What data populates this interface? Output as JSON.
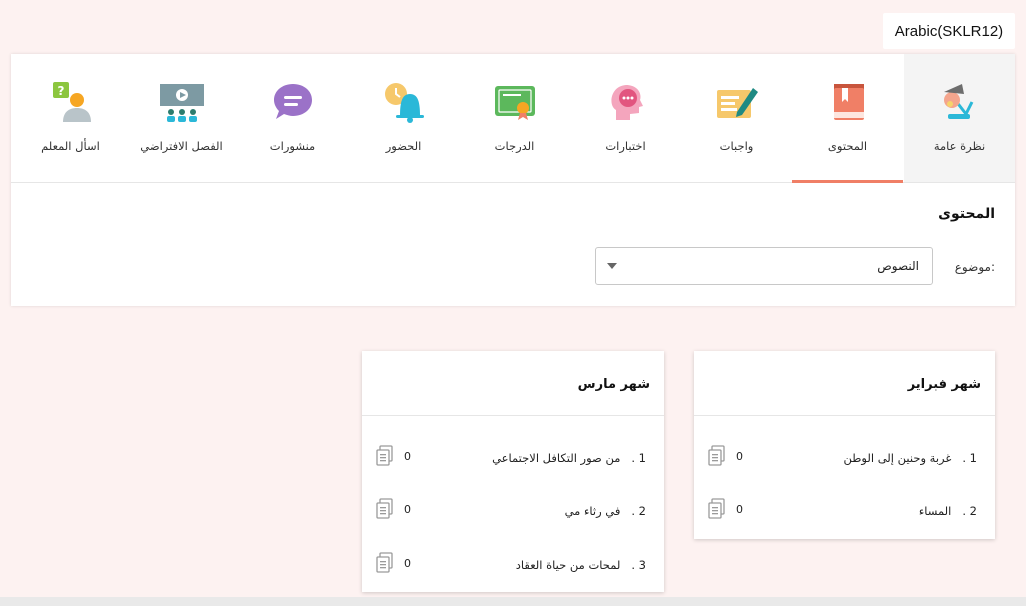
{
  "course": "Arabic(SKLR12)",
  "tabs": [
    {
      "label": "نظرة عامة",
      "icon": "lamp-icon"
    },
    {
      "label": "المحتوى",
      "icon": "book-icon",
      "active": true
    },
    {
      "label": "واجبات",
      "icon": "assignment-pen-icon"
    },
    {
      "label": "اختبارات",
      "icon": "quiz-head-icon"
    },
    {
      "label": "الدرجات",
      "icon": "certificate-icon"
    },
    {
      "label": "الحضور",
      "icon": "attendance-bell-icon"
    },
    {
      "label": "منشورات",
      "icon": "speech-bubble-icon"
    },
    {
      "label": "الفصل الافتراضي",
      "icon": "virtual-class-icon"
    },
    {
      "label": "اسأل المعلم",
      "icon": "ask-teacher-icon"
    }
  ],
  "content": {
    "title": "المحتوى",
    "topic_label": "موضوع:",
    "topic_value": "النصوص"
  },
  "cards": [
    {
      "title": "شهر فبراير",
      "items": [
        {
          "num": "1 .",
          "title": "غربة وحنين إلى الوطن",
          "count": "0"
        },
        {
          "num": "2 .",
          "title": "المساء",
          "count": "0"
        }
      ]
    },
    {
      "title": "شهر مارس",
      "items": [
        {
          "num": "1 .",
          "title": "من صور التكافل الاجتماعي",
          "count": "0"
        },
        {
          "num": "2 .",
          "title": "في رثاء مي",
          "count": "0"
        },
        {
          "num": "3 .",
          "title": "لمحات من حياة العقاد",
          "count": "0"
        }
      ]
    }
  ],
  "colors": {
    "accent": "#f07f66",
    "background": "#fdf2f1"
  }
}
